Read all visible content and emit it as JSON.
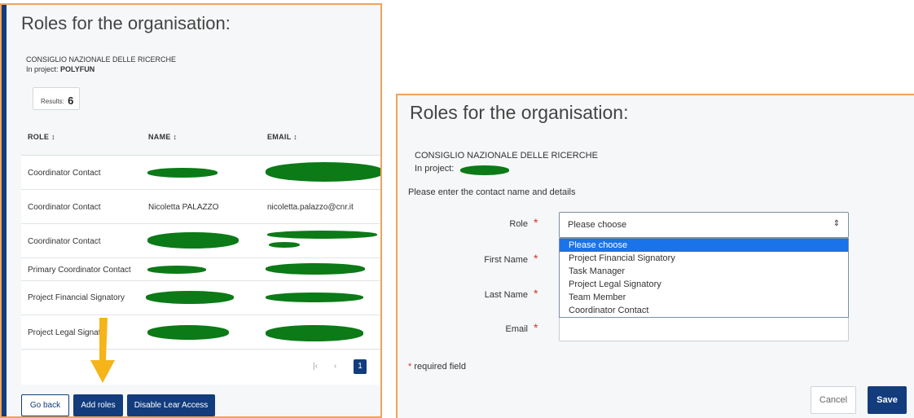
{
  "left": {
    "title": "Roles for the organisation:",
    "org": "CONSIGLIO NAZIONALE DELLE RICERCHE",
    "project_prefix": "In project: ",
    "project_name": "POLYFUN",
    "results_label": "Results:",
    "results_count": "6",
    "columns": [
      "ROLE ↕",
      "NAME ↕",
      "EMAIL ↕"
    ],
    "rows": [
      {
        "role": "Coordinator Contact",
        "name": "",
        "email": ""
      },
      {
        "role": "Coordinator Contact",
        "name": "Nicoletta PALAZZO",
        "email": "nicoletta.palazzo@cnr.it"
      },
      {
        "role": "Coordinator Contact",
        "name": "",
        "email": ""
      },
      {
        "role": "Primary Coordinator Contact",
        "name": "",
        "email": ""
      },
      {
        "role": "Project Financial Signatory",
        "name": "",
        "email": ""
      },
      {
        "role": "Project Legal Signat",
        "name": "",
        "email": ""
      }
    ],
    "pager": {
      "first": "|‹",
      "prev": "‹",
      "current": "1"
    },
    "buttons": {
      "go_back": "Go back",
      "add_roles": "Add roles",
      "disable": "Disable Lear Access"
    },
    "colors": {
      "accent": "#123c7c",
      "arrow": "#f5b41a",
      "redaction": "#0b7a17",
      "frame": "#f0a25a"
    }
  },
  "right": {
    "title": "Roles for the organisation:",
    "org": "CONSIGLIO NAZIONALE DELLE RICERCHE",
    "project_prefix": "In project:",
    "instructions": "Please enter the contact name and details",
    "labels": {
      "role": "Role",
      "first_name": "First Name",
      "last_name": "Last Name",
      "email": "Email"
    },
    "required_mark": "*",
    "role_select": {
      "value": "Please choose",
      "icon": "sort-arrows-icon"
    },
    "role_options": [
      "Please choose",
      "Project Financial Signatory",
      "Task Manager",
      "Project Legal Signatory",
      "Team Member",
      "Coordinator Contact"
    ],
    "required_note": "required field",
    "buttons": {
      "cancel": "Cancel",
      "save": "Save"
    }
  }
}
